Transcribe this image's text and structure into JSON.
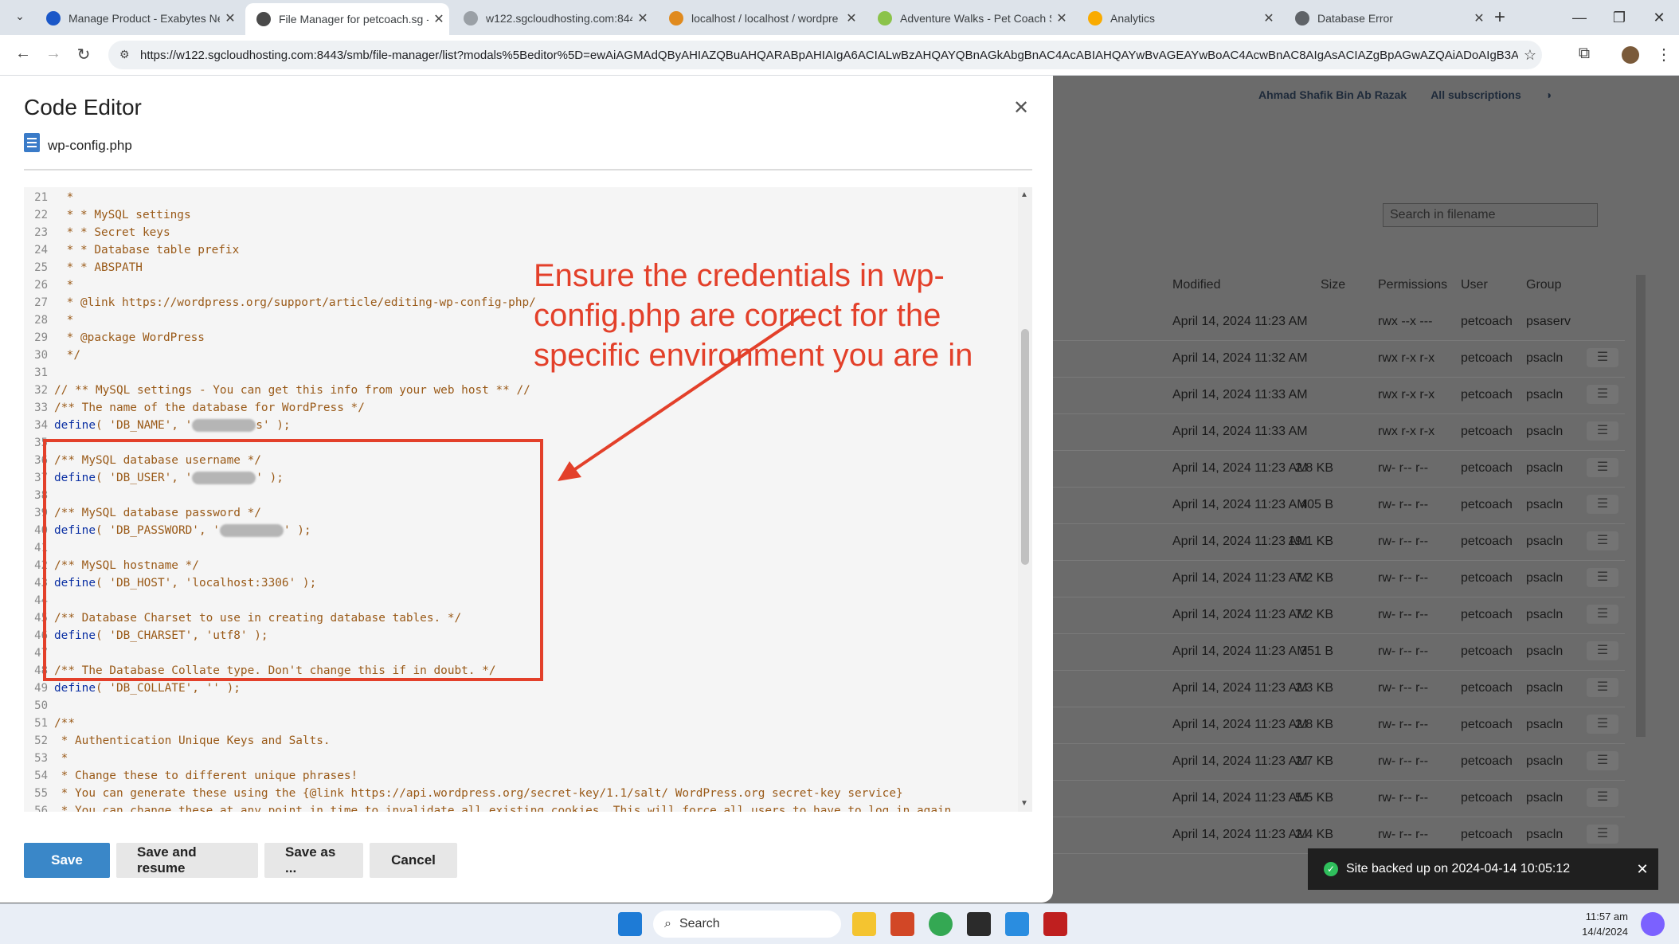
{
  "browser": {
    "tabs": [
      {
        "title": "Manage Product - Exabytes Ne",
        "fav_color": "#1a57c8"
      },
      {
        "title": "File Manager for petcoach.sg -",
        "fav_color": "#4a4a4a"
      },
      {
        "title": "w122.sgcloudhosting.com:8443",
        "fav_color": "#9aa0a6"
      },
      {
        "title": "localhost / localhost / wordpre",
        "fav_color": "#e08a1e"
      },
      {
        "title": "Adventure Walks - Pet Coach S",
        "fav_color": "#8bc34a"
      },
      {
        "title": "Analytics",
        "fav_color": "#f9ab00"
      },
      {
        "title": "Database Error",
        "fav_color": "#5f6368"
      }
    ],
    "url": "https://w122.sgcloudhosting.com:8443/smb/file-manager/list?modals%5Beditor%5D=ewAiAGMAdQByAHIAZQBuAHQARABpAHIAIgA6ACIALwBzAHQAYQBnAGkAbgBnAC4AcABIAHQAYwBvAGEAYwBoAC4AcwBnAC8AIgAsACIAZgBpAGwAZQAiADoAIgB3AH..."
  },
  "background": {
    "user": "Ahmad Shafik Bin Ab Razak",
    "subscriptions": "All subscriptions",
    "search_placeholder": "Search in filename",
    "columns": {
      "modified": "Modified",
      "size": "Size",
      "permissions": "Permissions",
      "user": "User",
      "group": "Group"
    },
    "rows": [
      {
        "modified": "April 14, 2024 11:23 AM",
        "size": "",
        "permissions": "rwx --x ---",
        "user": "petcoach",
        "group": "psaserv"
      },
      {
        "modified": "April 14, 2024 11:32 AM",
        "size": "",
        "permissions": "rwx r-x r-x",
        "user": "petcoach",
        "group": "psacln"
      },
      {
        "modified": "April 14, 2024 11:33 AM",
        "size": "",
        "permissions": "rwx r-x r-x",
        "user": "petcoach",
        "group": "psacln"
      },
      {
        "modified": "April 14, 2024 11:33 AM",
        "size": "",
        "permissions": "rwx r-x r-x",
        "user": "petcoach",
        "group": "psacln"
      },
      {
        "modified": "April 14, 2024 11:23 AM",
        "size": "2.8 KB",
        "permissions": "rw- r-- r--",
        "user": "petcoach",
        "group": "psacln"
      },
      {
        "modified": "April 14, 2024 11:23 AM",
        "size": "405 B",
        "permissions": "rw- r-- r--",
        "user": "petcoach",
        "group": "psacln"
      },
      {
        "modified": "April 14, 2024 11:23 AM",
        "size": "19.1 KB",
        "permissions": "rw- r-- r--",
        "user": "petcoach",
        "group": "psacln"
      },
      {
        "modified": "April 14, 2024 11:23 AM",
        "size": "7.2 KB",
        "permissions": "rw- r-- r--",
        "user": "petcoach",
        "group": "psacln"
      },
      {
        "modified": "April 14, 2024 11:23 AM",
        "size": "7.2 KB",
        "permissions": "rw- r-- r--",
        "user": "petcoach",
        "group": "psacln"
      },
      {
        "modified": "April 14, 2024 11:23 AM",
        "size": "351 B",
        "permissions": "rw- r-- r--",
        "user": "petcoach",
        "group": "psacln"
      },
      {
        "modified": "April 14, 2024 11:23 AM",
        "size": "2.3 KB",
        "permissions": "rw- r-- r--",
        "user": "petcoach",
        "group": "psacln"
      },
      {
        "modified": "April 14, 2024 11:23 AM",
        "size": "2.8 KB",
        "permissions": "rw- r-- r--",
        "user": "petcoach",
        "group": "psacln"
      },
      {
        "modified": "April 14, 2024 11:23 AM",
        "size": "2.7 KB",
        "permissions": "rw- r-- r--",
        "user": "petcoach",
        "group": "psacln"
      },
      {
        "modified": "April 14, 2024 11:23 AM",
        "size": "5.5 KB",
        "permissions": "rw- r-- r--",
        "user": "petcoach",
        "group": "psacln"
      },
      {
        "modified": "April 14, 2024 11:23 AM",
        "size": "2.4 KB",
        "permissions": "rw- r-- r--",
        "user": "petcoach",
        "group": "psacln"
      }
    ],
    "toast": "Site backed up on 2024-04-14 10:05:12"
  },
  "modal": {
    "title": "Code Editor",
    "file_name": "wp-config.php",
    "annotation": "Ensure the credentials in wp-config.php are correct for the specific environment you are in",
    "code_lines": [
      {
        "n": "21",
        "t": " *"
      },
      {
        "n": "22",
        "t": " * * MySQL settings"
      },
      {
        "n": "23",
        "t": " * * Secret keys"
      },
      {
        "n": "24",
        "t": " * * Database table prefix"
      },
      {
        "n": "25",
        "t": " * * ABSPATH"
      },
      {
        "n": "26",
        "t": " *"
      },
      {
        "n": "27",
        "t": " * @link https://wordpress.org/support/article/editing-wp-config-php/"
      },
      {
        "n": "28",
        "t": " *"
      },
      {
        "n": "29",
        "t": " * @package WordPress"
      },
      {
        "n": "30",
        "t": " */"
      },
      {
        "n": "31",
        "t": ""
      },
      {
        "n": "32",
        "t": "// ** MySQL settings - You can get this info from your web host ** //"
      },
      {
        "n": "33",
        "t": "/** The name of the database for WordPress */"
      },
      {
        "n": "34",
        "t": "define( 'DB_NAME', '",
        "kw": true,
        "masked": true,
        "after": "s' );"
      },
      {
        "n": "35",
        "t": ""
      },
      {
        "n": "36",
        "t": "/** MySQL database username */"
      },
      {
        "n": "37",
        "t": "define( 'DB_USER', '",
        "kw": true,
        "masked": true,
        "after": "' );"
      },
      {
        "n": "38",
        "t": ""
      },
      {
        "n": "39",
        "t": "/** MySQL database password */"
      },
      {
        "n": "40",
        "t": "define( 'DB_PASSWORD', '",
        "kw": true,
        "masked": true,
        "after": "' );"
      },
      {
        "n": "41",
        "t": ""
      },
      {
        "n": "42",
        "t": "/** MySQL hostname */"
      },
      {
        "n": "43",
        "t": "define( 'DB_HOST', 'localhost:3306' );",
        "kw": true
      },
      {
        "n": "44",
        "t": ""
      },
      {
        "n": "45",
        "t": "/** Database Charset to use in creating database tables. */"
      },
      {
        "n": "46",
        "t": "define( 'DB_CHARSET', 'utf8' );",
        "kw": true
      },
      {
        "n": "47",
        "t": ""
      },
      {
        "n": "48",
        "t": "/** The Database Collate type. Don't change this if in doubt. */"
      },
      {
        "n": "49",
        "t": "define( 'DB_COLLATE', '' );",
        "kw": true
      },
      {
        "n": "50",
        "t": ""
      },
      {
        "n": "51",
        "t": "/**"
      },
      {
        "n": "52",
        "t": " * Authentication Unique Keys and Salts."
      },
      {
        "n": "53",
        "t": " *"
      },
      {
        "n": "54",
        "t": " * Change these to different unique phrases!"
      },
      {
        "n": "55",
        "t": " * You can generate these using the {@link https://api.wordpress.org/secret-key/1.1/salt/ WordPress.org secret-key service}"
      },
      {
        "n": "56",
        "t": " * You can change these at any point in time to invalidate all existing cookies. This will force all users to have to log in again."
      }
    ],
    "buttons": {
      "save": "Save",
      "save_resume": "Save and resume",
      "save_as": "Save as ...",
      "cancel": "Cancel"
    }
  },
  "taskbar": {
    "search": "Search",
    "time": "11:57 am",
    "date": "14/4/2024"
  }
}
